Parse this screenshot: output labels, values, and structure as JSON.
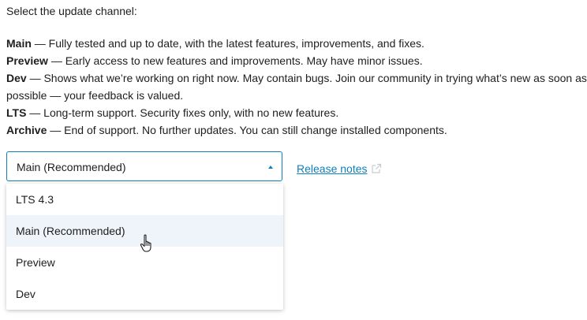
{
  "intro": "Select the update channel:",
  "channels": [
    {
      "name": "Main",
      "desc": " — Fully tested and up to date, with the latest features, improvements, and fixes."
    },
    {
      "name": "Preview",
      "desc": " — Early access to new features and improvements. May have minor issues."
    },
    {
      "name": "Dev",
      "desc": " — Shows what we’re working on right now. May contain bugs. Join our community in trying what’s new as soon as possible — your feedback is valued."
    },
    {
      "name": "LTS",
      "desc": " — Long-term support. Security fixes only, with no new features."
    },
    {
      "name": "Archive",
      "desc": " — End of support. No further updates. You can still change installed components."
    }
  ],
  "select": {
    "value": "Main (Recommended)",
    "expanded": true,
    "options": [
      "LTS 4.3",
      "Main (Recommended)",
      "Preview",
      "Dev"
    ],
    "hovered_option": "Main (Recommended)"
  },
  "release_notes": {
    "label": "Release notes",
    "icon": "external-link-icon"
  },
  "colors": {
    "accent": "#0f7eb9",
    "hover": "#eef4fa",
    "text": "#1e1e1e"
  }
}
